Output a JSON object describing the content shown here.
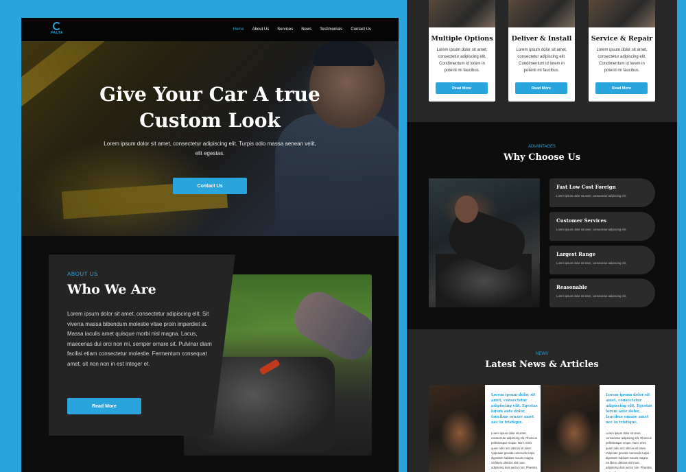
{
  "nav": {
    "logo_text": "FALTA",
    "items": [
      "Home",
      "About Us",
      "Services",
      "News",
      "Testimonials",
      "Contact Us"
    ]
  },
  "hero": {
    "title_line1": "Give Your Car A true",
    "title_line2": "Custom Look",
    "subtitle": "Lorem ipsum dolor sit amet, consectetur adipiscing elit. Turpis odio massa aenean velit, elit egestas.",
    "button": "Contact Us"
  },
  "about": {
    "kicker": "ABOUT US",
    "title": "Who We Are",
    "text": "Lorem ipsum dolor sit amet, consectetur adipiscing elit. Sit viverra massa bibendum molestie vitae proin imperdiet at. Massa iaculis amet quisque morbi nisl magna. Lacus, maecenas dui orci non mi, semper ornare sit. Pulvinar diam facilisi etiam consectetur molestie. Fermentum consequat amet, sit non non in est integer et.",
    "button": "Read More"
  },
  "services": [
    {
      "title": "Multiple Options",
      "desc": "Lorem ipsum dolor sit amet, consectetur adipiscing elit. Condimentum id lorem in potenti mi faucibus.",
      "button": "Read More"
    },
    {
      "title": "Deliver & Install",
      "desc": "Lorem ipsum dolor sit amet, consectetur adipiscing elit. Condimentum id lorem in potenti mi faucibus.",
      "button": "Read More"
    },
    {
      "title": "Service & Repair",
      "desc": "Lorem ipsum dolor sit amet, consectetur adipiscing elit. Condimentum id lorem in potenti mi faucibus.",
      "button": "Read More"
    }
  ],
  "why": {
    "kicker": "ADVANTAGES",
    "title": "Why Choose Us",
    "features": [
      {
        "title": "Fast Low Cost Foreign",
        "desc": "Lorem ipsum dolor sit amet, consectetur adipiscing elit."
      },
      {
        "title": "Customer Services",
        "desc": "Lorem ipsum dolor sit amet, consectetur adipiscing elit."
      },
      {
        "title": "Largest Range",
        "desc": "Lorem ipsum dolor sit amet, consectetur adipiscing elit."
      },
      {
        "title": "Reasonable",
        "desc": "Lorem ipsum dolor sit amet, consectetur adipiscing elit."
      }
    ]
  },
  "news": {
    "kicker": "NEWS",
    "title": "Latest News & Articles",
    "articles": [
      {
        "headline": "Lorem ipsum dolor sit amet, consectetur adipiscing elit. Egestas lorem ante dolor, faucibus ornare amet nec in tristique.",
        "body": "Lorem ipsum dolor sit amet, consectetur adipiscing elit. Rhoncus pellentesque neque. Nunc enim quam odio orci ultrices sit amet. Vulputate gravida commodo turpis dignissim habitant mauris magna. Sit libero ultricies nisl nunc adipiscing duis auctor non. Pharetra in fringilla penatibus non."
      },
      {
        "headline": "Lorem ipsum dolor sit amet, consectetur adipiscing elit. Egestas lorem ante dolor, faucibus ornare amet nec in tristique.",
        "body": "Lorem ipsum dolor sit amet, consectetur adipiscing elit. Rhoncus pellentesque neque. Nunc enim quam odio orci ultrices sit amet. Vulputate gravida commodo turpis dignissim habitant mauris magna. Sit libero ultricies nisl nunc adipiscing duis auctor non. Pharetra in fringilla penatibus non."
      }
    ]
  },
  "colors": {
    "accent": "#29a4dd",
    "background": "#29a4dd",
    "dark": "#0d0d0d",
    "panel": "#272727"
  }
}
